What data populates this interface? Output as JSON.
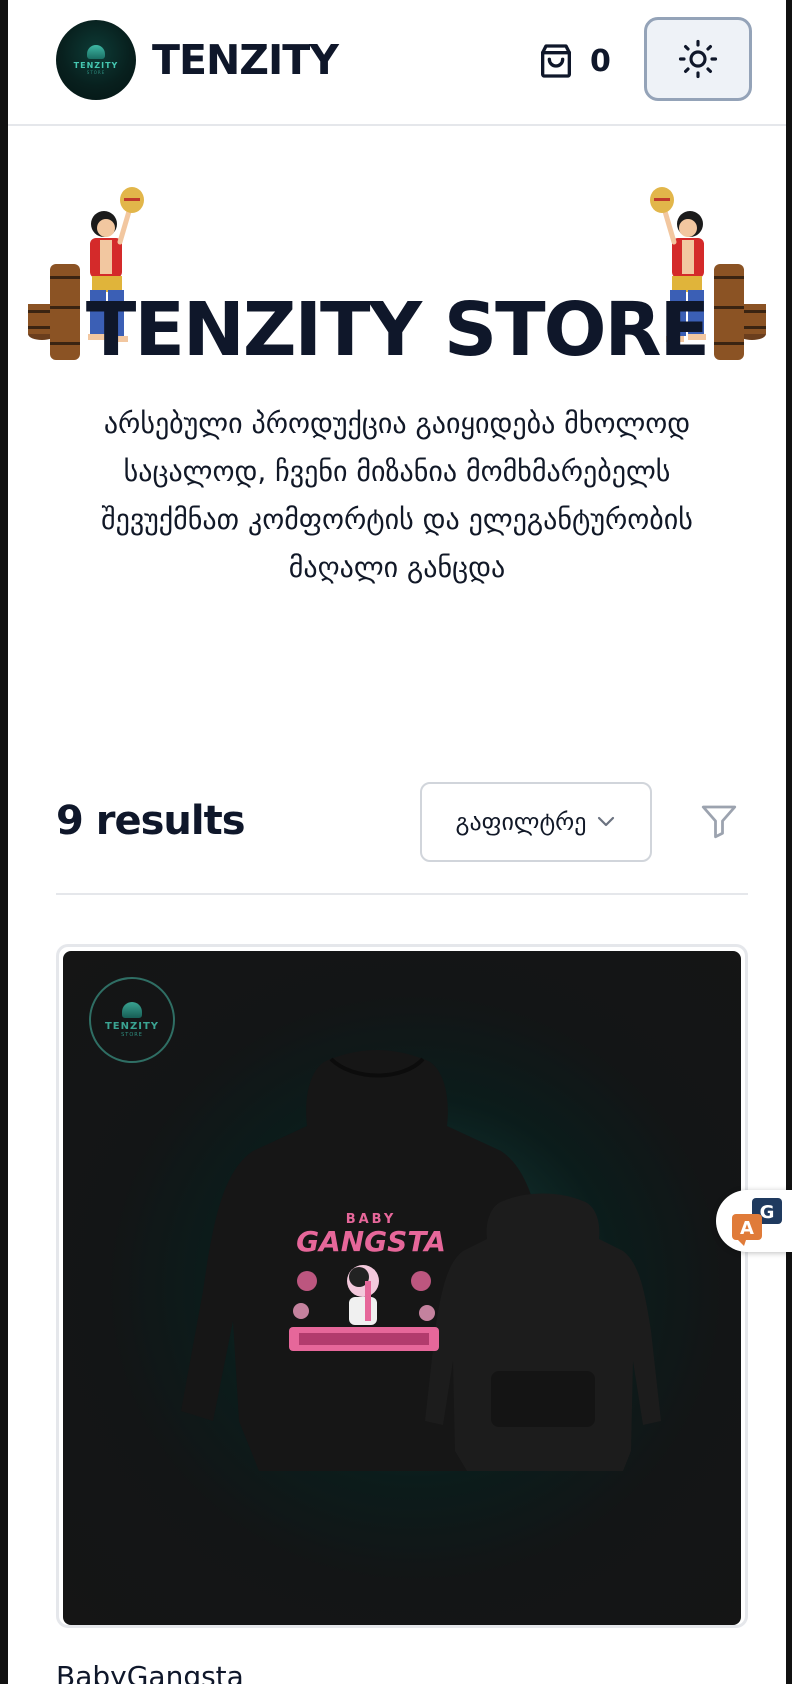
{
  "header": {
    "logo_text": "TENZITY",
    "logo_sub": "STORE",
    "brand": "TENZITY",
    "cart_count": "0"
  },
  "hero": {
    "title": "TENZITY STORE",
    "description": "არსებული პროდუქცია გაიყიდება მხოლოდ საცალოდ, ჩვენი მიზანია მომხმარებელს შევუქმნათ კომფორტის და ელეგანტურობის მაღალი განცდა"
  },
  "filters": {
    "results": "9 results",
    "sort_label": "გაფილტრე"
  },
  "product": {
    "name": "BabyGangsta",
    "image_logo_text": "TENZITY",
    "image_logo_sub": "STORE",
    "print_top": "BABY",
    "print_main": "GANGSTA"
  },
  "icons": {
    "cart": "shopping-bag-icon",
    "theme": "sun-icon",
    "sort": "chevron-down-icon",
    "filter": "funnel-icon",
    "translate": "translate-icon"
  },
  "colors": {
    "text": "#0f172a",
    "border": "#e5e7eb",
    "theme_button_bg": "#eef2f7",
    "theme_button_border": "#94a3b8",
    "brand_teal": "#45c7b1",
    "print_pink": "#e6679a"
  }
}
